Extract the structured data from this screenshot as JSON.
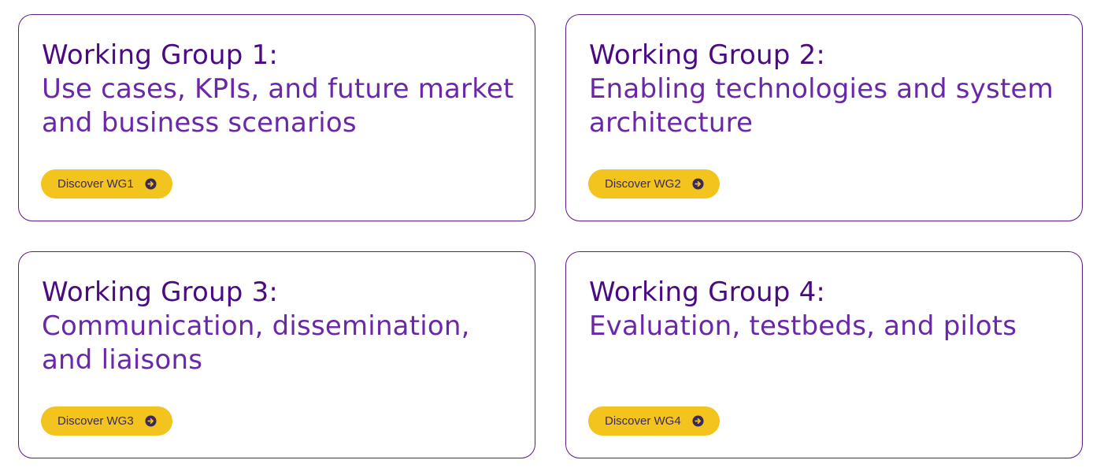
{
  "working_groups": [
    {
      "title": "Working Group 1:",
      "subtitle": "Use cases, KPIs, and future market and business scenarios",
      "button_label": "Discover WG1",
      "button_icon": "arrow-circle-right-icon"
    },
    {
      "title": "Working Group 2:",
      "subtitle": "Enabling technologies and system architecture",
      "button_label": "Discover WG2",
      "button_icon": "arrow-circle-right-icon"
    },
    {
      "title": "Working Group 3:",
      "subtitle": "Communication, dissemination, and liaisons",
      "button_label": "Discover WG3",
      "button_icon": "arrow-circle-right-icon"
    },
    {
      "title": "Working Group 4:",
      "subtitle": "Evaluation, testbeds, and pilots",
      "button_label": "Discover WG4",
      "button_icon": "arrow-circle-right-icon"
    }
  ],
  "colors": {
    "accent_purple": "#5a1a8c",
    "button_yellow": "#f3c41e",
    "button_text": "#3a2a5a"
  }
}
